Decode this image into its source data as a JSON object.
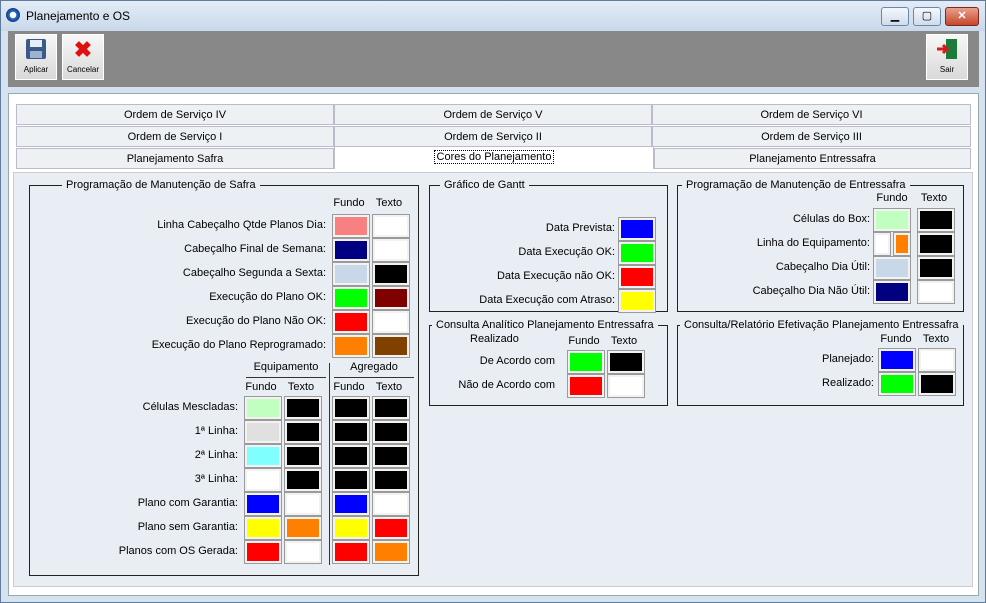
{
  "window": {
    "title": "Planejamento e OS"
  },
  "toolbar": {
    "aplicar": "Aplicar",
    "cancelar": "Cancelar",
    "sair": "Sair"
  },
  "tabs": [
    "Ordem de Serviço IV",
    "Ordem de Serviço V",
    "Ordem de Serviço VI",
    "Ordem de Serviço I",
    "Ordem de Serviço II",
    "Ordem de Serviço III",
    "Planejamento Safra",
    "Cores do Planejamento",
    "Planejamento Entressafra"
  ],
  "safra": {
    "legend": "Programação de Manutenção de Safra",
    "fundo": "Fundo",
    "texto": "Texto",
    "rows": [
      {
        "label": "Linha Cabeçalho Qtde Planos Dia:",
        "fundo": "#f88080",
        "texto": "#ffffff"
      },
      {
        "label": "Cabeçalho Final de Semana:",
        "fundo": "#000080",
        "texto": "#ffffff"
      },
      {
        "label": "Cabeçalho Segunda a Sexta:",
        "fundo": "#c8d8e8",
        "texto": "#000000"
      },
      {
        "label": "Execução do Plano OK:",
        "fundo": "#00ff00",
        "texto": "#800000"
      },
      {
        "label": "Execução do Plano Não OK:",
        "fundo": "#ff0000",
        "texto": "#ffffff"
      },
      {
        "label": "Execução do Plano Reprogramado:",
        "fundo": "#ff8000",
        "texto": "#804000"
      }
    ],
    "equipamento": "Equipamento",
    "agregado": "Agregado",
    "grid": [
      {
        "label": "Células Mescladas:",
        "ef": "#c0ffc0",
        "et": "#000000",
        "af": "#000000",
        "at": "#000000"
      },
      {
        "label": "1ª Linha:",
        "ef": "#e0e0e0",
        "et": "#000000",
        "af": "#000000",
        "at": "#000000"
      },
      {
        "label": "2ª Linha:",
        "ef": "#80ffff",
        "et": "#000000",
        "af": "#000000",
        "at": "#000000"
      },
      {
        "label": "3ª Linha:",
        "ef": "#ffffff",
        "et": "#000000",
        "af": "#000000",
        "at": "#000000"
      },
      {
        "label": "Plano com Garantia:",
        "ef": "#0000ff",
        "et": "#ffffff",
        "af": "#0000ff",
        "at": "#ffffff"
      },
      {
        "label": "Plano sem Garantia:",
        "ef": "#ffff00",
        "et": "#ff8000",
        "af": "#ffff00",
        "at": "#ff0000"
      },
      {
        "label": "Planos com OS Gerada:",
        "ef": "#ff0000",
        "et": "#ffffff",
        "af": "#ff0000",
        "at": "#ff8000"
      }
    ]
  },
  "gantt": {
    "legend": "Gráfico de Gantt",
    "rows": [
      {
        "label": "Data Prevista:",
        "color": "#0000ff"
      },
      {
        "label": "Data Execução OK:",
        "color": "#00ff00"
      },
      {
        "label": "Data Execução não OK:",
        "color": "#ff0000"
      },
      {
        "label": "Data Execução com Atraso:",
        "color": "#ffff00"
      }
    ]
  },
  "entressafra": {
    "legend": "Programação de Manutenção de Entressafra",
    "fundo": "Fundo",
    "texto": "Texto",
    "rows": [
      {
        "label": "Células do Box:",
        "fundo": "#c0ffc0",
        "texto": "#000000"
      },
      {
        "label": "Linha do Equipamento:",
        "fundo": "#ffffff",
        "fundo2": "#ff8000",
        "texto": "#000000"
      },
      {
        "label": "Cabeçalho Dia Útil:",
        "fundo": "#c8d8e8",
        "texto": "#000000"
      },
      {
        "label": "Cabeçalho Dia Não Útil:",
        "fundo": "#000080",
        "texto": "#ffffff"
      }
    ]
  },
  "consulta": {
    "legend": "Consulta Analítico Planejamento Entressafra",
    "realizado": "Realizado",
    "fundo": "Fundo",
    "texto": "Texto",
    "rows": [
      {
        "label": "De Acordo com",
        "fundo": "#00ff00",
        "texto": "#000000"
      },
      {
        "label": "Não de Acordo com",
        "fundo": "#ff0000",
        "texto": "#ffffff"
      }
    ]
  },
  "efetivacao": {
    "legend": "Consulta/Relatório Efetivação Planejamento Entressafra",
    "fundo": "Fundo",
    "texto": "Texto",
    "rows": [
      {
        "label": "Planejado:",
        "fundo": "#0000ff",
        "texto": "#ffffff"
      },
      {
        "label": "Realizado:",
        "fundo": "#00ff00",
        "texto": "#000000"
      }
    ]
  }
}
